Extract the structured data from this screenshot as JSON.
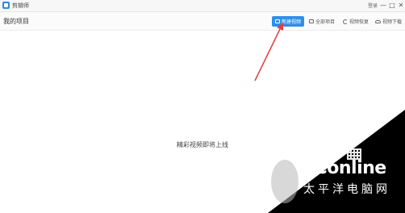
{
  "app": {
    "title": "剪辑师",
    "login": "登录"
  },
  "window_controls": {
    "minimize": "—",
    "maximize": "□",
    "close": "✕"
  },
  "toolbar": {
    "page_title": "我的项目",
    "new_video": "新建视频",
    "all_projects": "全部项目",
    "video_restore": "视频恢复",
    "video_download": "视频下载"
  },
  "main": {
    "empty_message": "精彩视频即将上线"
  },
  "watermark": {
    "brand": "PConline",
    "subtitle": "太平洋电脑网"
  },
  "colors": {
    "primary": "#2f8fe8",
    "arrow": "#e04040"
  }
}
